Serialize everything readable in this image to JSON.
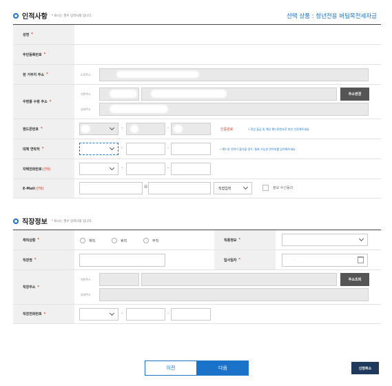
{
  "personal": {
    "title": "인적사항",
    "req_note_star": "*",
    "req_note_text": " 표시는 필수 입력사항 입니다.",
    "product": "선택 상품 : 청년전용 버팀목전세자금",
    "rows": {
      "name": "성명",
      "rrn": "주민등록번호",
      "address": "현 거주지 주소",
      "mail_address": "우편물 수령 주소",
      "mobile": "핸드폰번호",
      "alt_phone": "대체 연락처",
      "home_phone": "자택전화번호",
      "home_phone_opt": "(선택)",
      "email": "E-Mail",
      "email_opt": "(선택)"
    },
    "sub_labels": {
      "road_address": "도로주소",
      "street_address": "지번주소",
      "detail_address": "상세주소"
    },
    "change_address_button": "주소변경",
    "cert_verified": "인증완료",
    "mobile_note": "• 정상 출금 및 해당 핸드폰번호로 본인 인증해주세요.",
    "alt_note": "• 핸드폰 연락이 불가할 경우, 통화 가능한 연락처를 입력해주세요.",
    "at_sign": "@",
    "email_domain_select": "직접입력",
    "marketing_consent": "정보 수신동의"
  },
  "job": {
    "title": "직장정보",
    "req_note_star": "*",
    "req_note_text": " 표시는 필수 입력사항 입니다.",
    "rows": {
      "employment_status": "재직상황",
      "employment_type": "직종정보",
      "company_name": "직장명",
      "hire_date": "입사일자",
      "company_address": "직장주소",
      "company_phone": "직장전화번호"
    },
    "radios": [
      "재직",
      "휴직",
      "무직"
    ],
    "date_placeholder": ". .",
    "search_address_button": "주소조회",
    "sub_labels": {
      "street_address": "지번주소",
      "detail_address": "상세주소"
    }
  },
  "footer": {
    "prev_button": "이전",
    "next_button": "다음",
    "cancel_button": "신청취소"
  },
  "colors": {
    "accent_blue": "#1a73c9",
    "required_red": "#d9402b",
    "header_gray": "#f0f0f0",
    "dark_button": "#555555"
  }
}
